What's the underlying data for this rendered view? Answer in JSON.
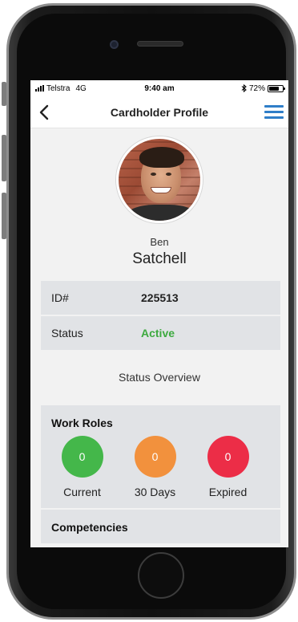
{
  "status_bar": {
    "carrier": "Telstra",
    "network": "4G",
    "time": "9:40 am",
    "bluetooth_icon": "bluetooth-icon",
    "battery_percent_text": "72%",
    "battery_level": 0.72
  },
  "nav": {
    "title": "Cardholder Profile",
    "back_icon": "chevron-left-icon",
    "menu_icon": "hamburger-menu-icon",
    "accent_color": "#2f7ec8"
  },
  "profile": {
    "first_name": "Ben",
    "last_name": "Satchell",
    "id_label": "ID#",
    "id_value": "225513",
    "status_label": "Status",
    "status_value": "Active",
    "status_color": "#3daa3f"
  },
  "status_overview": {
    "caption": "Status Overview"
  },
  "work_roles": {
    "title": "Work Roles",
    "items": [
      {
        "count": "0",
        "label": "Current",
        "color": "#44b74a"
      },
      {
        "count": "0",
        "label": "30 Days",
        "color": "#f2913d"
      },
      {
        "count": "0",
        "label": "Expired",
        "color": "#ec2d47"
      }
    ]
  },
  "competencies": {
    "title": "Competencies"
  }
}
